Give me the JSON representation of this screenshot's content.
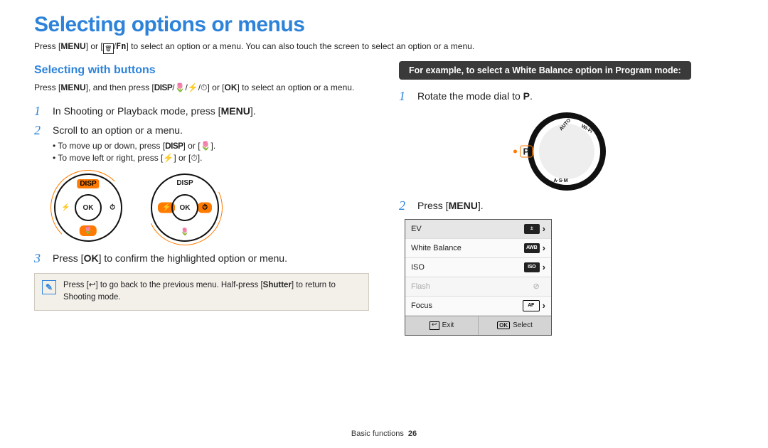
{
  "title": "Selecting options or menus",
  "intro": "Press [MENU] or [🗑/Fn] to select an option or a menu. You can also touch the screen to select an option or a menu.",
  "section_left": {
    "heading": "Selecting with buttons",
    "para": "Press [MENU], and then press [DISP/🌷/⚡/⏱] or [OK] to select an option or a menu.",
    "steps": [
      {
        "n": "1",
        "text": "In Shooting or Playback mode, press [MENU]."
      },
      {
        "n": "2",
        "text": "Scroll to an option or a menu.",
        "sub": [
          "To move up or down, press [DISP] or [🌷].",
          "To move left or right, press [⚡] or [⏱]."
        ]
      },
      {
        "n": "3",
        "text": "Press [OK] to confirm the highlighted option or menu."
      }
    ],
    "wheel_labels": {
      "top": "DISP",
      "bottom": "🌷",
      "left": "⚡",
      "right": "⏱",
      "ok": "OK"
    },
    "note": "Press [↩] to go back to the previous menu. Half-press [Shutter] to return to Shooting mode."
  },
  "section_right": {
    "example_label": "For example, to select a White Balance option in Program mode:",
    "steps": [
      {
        "n": "1",
        "text": "Rotate the mode dial to P."
      },
      {
        "n": "2",
        "text": "Press [MENU]."
      }
    ],
    "dial": {
      "mode": "P",
      "labels": {
        "auto": "AUTO",
        "wifi": "Wi-Fi",
        "asm": "A·S·M"
      }
    },
    "menu": {
      "rows": [
        {
          "label": "EV",
          "value_icon": "±",
          "caret": true,
          "state": "active"
        },
        {
          "label": "White Balance",
          "value_icon": "AWB",
          "caret": true,
          "state": "normal"
        },
        {
          "label": "ISO",
          "value_icon": "ISO",
          "caret": true,
          "state": "normal"
        },
        {
          "label": "Flash",
          "value_icon": "⊘",
          "caret": false,
          "state": "disabled"
        },
        {
          "label": "Focus",
          "value_icon": "[AF]",
          "caret": true,
          "state": "normal",
          "af": true
        }
      ],
      "bar": {
        "left": "Exit",
        "right": "Select",
        "right_badge": "OK"
      }
    }
  },
  "footer": {
    "section": "Basic functions",
    "page": "26"
  }
}
